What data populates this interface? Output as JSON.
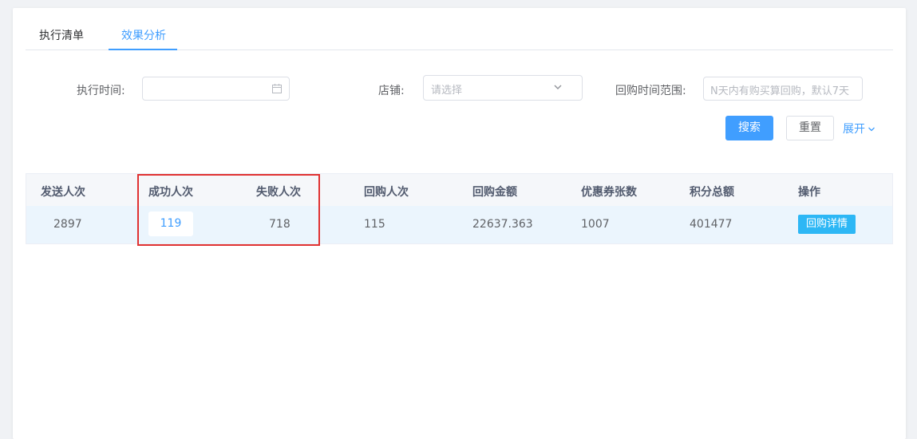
{
  "tabs": [
    {
      "label": "执行清单"
    },
    {
      "label": "效果分析",
      "active": true
    }
  ],
  "filters": {
    "exec_time_label": "执行时间:",
    "exec_time_value": "",
    "store_label": "店铺:",
    "store_placeholder": "请选择",
    "repurchase_range_label": "回购时间范围:",
    "repurchase_range_placeholder": "N天内有购买算回购，默认7天"
  },
  "buttons": {
    "search": "搜索",
    "reset": "重置",
    "expand": "展开"
  },
  "table": {
    "headers": [
      "发送人次",
      "成功人次",
      "失败人次",
      "回购人次",
      "回购金额",
      "优惠券张数",
      "积分总额",
      "操作"
    ],
    "rows": [
      {
        "sent": "2897",
        "success": "119",
        "failed": "718",
        "repurchase_count": "115",
        "repurchase_amount": "22637.363",
        "coupon_count": "1007",
        "points_total": "401477",
        "action": "回购详情"
      }
    ]
  },
  "colors": {
    "accent": "#409eff",
    "action_button": "#2db7f5",
    "highlight_box": "#e03232"
  },
  "icons": {
    "date": "calendar-icon",
    "select": "chevron-down-icon",
    "expand": "chevron-down-icon"
  }
}
